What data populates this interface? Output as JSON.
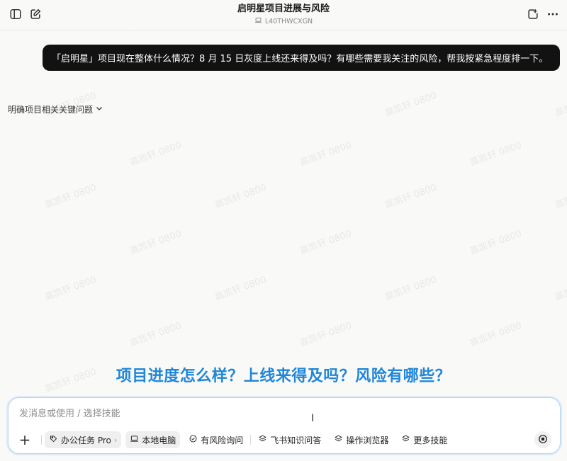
{
  "header": {
    "title": "启明星项目进展与风险",
    "device": "L40THWCXGN",
    "icons": {
      "sidebar": "sidebar-toggle-icon",
      "new_chat": "edit-icon",
      "share": "share-icon",
      "more": "more-icon",
      "device": "laptop-icon"
    }
  },
  "conversation": {
    "user_message": "「启明星」项目现在整体什么情况？8 月 15 日灰度上线还来得及吗？有哪些需要我关注的风险，帮我按紧急程度排一下。",
    "clarify_label": "明确项目相关关键问题"
  },
  "highlight": {
    "question": "项目进度怎么样？上线来得及吗？风险有哪些？"
  },
  "composer": {
    "placeholder": "发消息或使用 / 选择技能",
    "tools": {
      "office_task": "办公任务 Pro",
      "local_pc": "本地电脑",
      "risk_query": "有风险询问",
      "feishu_qa": "飞书知识问答",
      "browser": "操作浏览器",
      "more_skills": "更多技能"
    }
  },
  "watermark": {
    "text": "高凯轩 0800"
  },
  "colors": {
    "accent_blue": "#1f86d9",
    "user_bubble": "#121212",
    "composer_border": "#b9d5f5"
  }
}
